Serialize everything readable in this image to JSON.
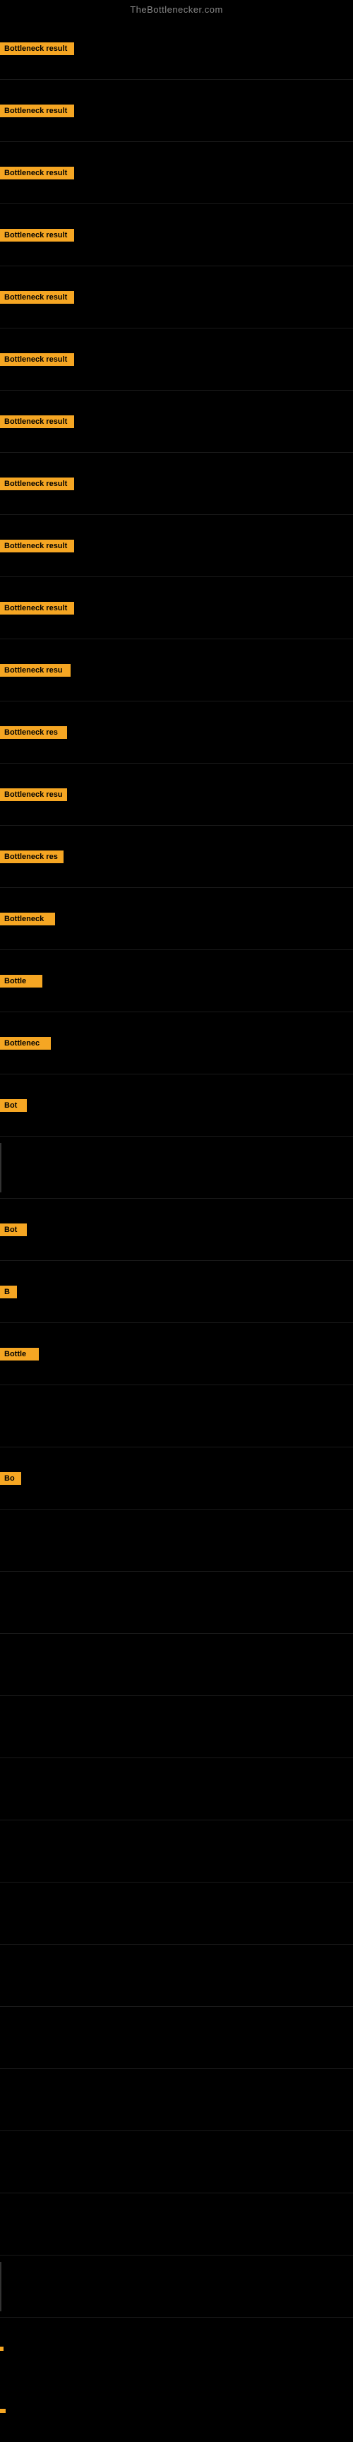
{
  "site": {
    "title": "TheBottlenecker.com"
  },
  "rows": [
    {
      "id": 1,
      "label": "Bottleneck result",
      "badge_text": "Bottleneck result"
    },
    {
      "id": 2,
      "label": "Bottleneck result",
      "badge_text": "Bottleneck result"
    },
    {
      "id": 3,
      "label": "Bottleneck result",
      "badge_text": "Bottleneck result"
    },
    {
      "id": 4,
      "label": "Bottleneck result",
      "badge_text": "Bottleneck result"
    },
    {
      "id": 5,
      "label": "Bottleneck result",
      "badge_text": "Bottleneck result"
    },
    {
      "id": 6,
      "label": "Bottleneck result",
      "badge_text": "Bottleneck result"
    },
    {
      "id": 7,
      "label": "Bottleneck result",
      "badge_text": "Bottleneck result"
    },
    {
      "id": 8,
      "label": "Bottleneck result",
      "badge_text": "Bottleneck result"
    },
    {
      "id": 9,
      "label": "Bottleneck result",
      "badge_text": "Bottleneck result"
    },
    {
      "id": 10,
      "label": "Bottleneck result",
      "badge_text": "Bottleneck result"
    },
    {
      "id": 11,
      "label": "Bottleneck resu",
      "badge_text": "Bottleneck resu"
    },
    {
      "id": 12,
      "label": "Bottleneck res",
      "badge_text": "Bottleneck res"
    },
    {
      "id": 13,
      "label": "Bottleneck resu",
      "badge_text": "Bottleneck resu"
    },
    {
      "id": 14,
      "label": "Bottleneck res",
      "badge_text": "Bottleneck res"
    },
    {
      "id": 15,
      "label": "Bottleneck",
      "badge_text": "Bottleneck"
    },
    {
      "id": 16,
      "label": "Bottle",
      "badge_text": "Bottle"
    },
    {
      "id": 17,
      "label": "Bottlenec",
      "badge_text": "Bottlenec"
    },
    {
      "id": 18,
      "label": "Bot",
      "badge_text": "Bot"
    },
    {
      "id": 19,
      "label": "",
      "badge_text": ""
    },
    {
      "id": 20,
      "label": "Bot",
      "badge_text": "Bot"
    },
    {
      "id": 21,
      "label": "B",
      "badge_text": "B"
    },
    {
      "id": 22,
      "label": "Bottle",
      "badge_text": "Bottle"
    },
    {
      "id": 23,
      "label": "",
      "badge_text": ""
    },
    {
      "id": 24,
      "label": "Bo",
      "badge_text": "Bo"
    }
  ],
  "empty_rows": 12,
  "colors": {
    "badge_bg": "#f5a623",
    "site_title": "#888888",
    "background": "#000000"
  }
}
